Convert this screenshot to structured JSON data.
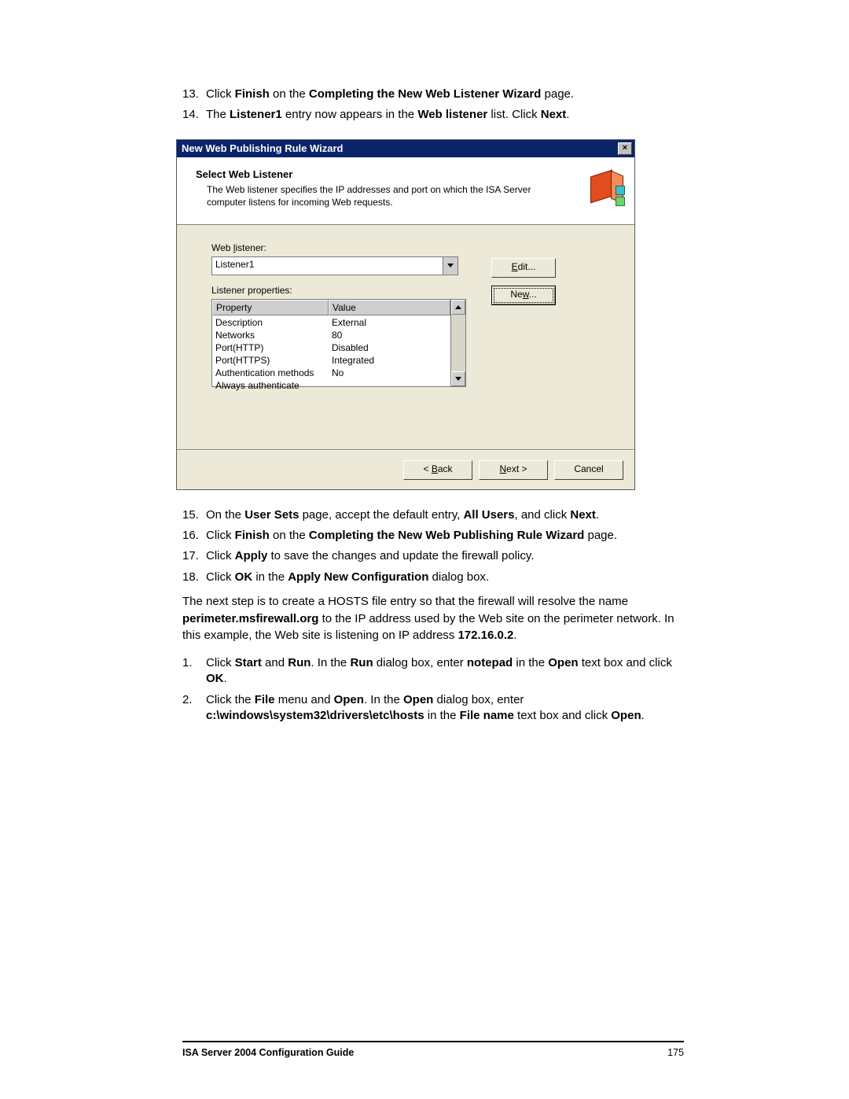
{
  "steps_top": [
    {
      "num": "13.",
      "html": "Click <b>Finish</b> on the <b>Completing the New Web Listener Wizard</b> page."
    },
    {
      "num": "14.",
      "html": "The <b>Listener1</b> entry now appears in the <b>Web listener</b> list. Click <b>Next</b>."
    }
  ],
  "dialog": {
    "title": "New Web Publishing Rule Wizard",
    "close": "×",
    "header_title": "Select Web Listener",
    "header_desc": "The Web listener specifies the IP addresses and port on which the ISA Server computer listens for incoming Web requests.",
    "web_listener_label": "Web listener:",
    "combo_value": "Listener1",
    "edit_btn": "Edit...",
    "new_btn": "New...",
    "listener_props_label": "Listener properties:",
    "col_property": "Property",
    "col_value": "Value",
    "rows": [
      {
        "p": "Description",
        "v": ""
      },
      {
        "p": "Networks",
        "v": "External"
      },
      {
        "p": "Port(HTTP)",
        "v": "80"
      },
      {
        "p": "Port(HTTPS)",
        "v": "Disabled"
      },
      {
        "p": "Authentication methods",
        "v": "Integrated"
      },
      {
        "p": "Always authenticate",
        "v": "No"
      }
    ],
    "back": "< Back",
    "next": "Next >",
    "cancel": "Cancel"
  },
  "steps_mid": [
    {
      "num": "15.",
      "html": "On the <b>User Sets</b> page, accept the default entry, <b>All Users</b>, and click <b>Next</b>."
    },
    {
      "num": "16.",
      "html": "Click <b>Finish</b> on the <b>Completing the New Web Publishing Rule Wizard</b> page."
    },
    {
      "num": "17.",
      "html": "Click <b>Apply</b> to save the changes and update the firewall policy."
    },
    {
      "num": "18.",
      "html": "Click <b>OK</b> in the <b>Apply New Configuration</b> dialog box."
    }
  ],
  "paragraph": "The next step is to create a HOSTS file entry so that the firewall will resolve the name <b>perimeter.msfirewall.org</b> to the IP address used by the Web site on the perimeter network. In this example, the Web site is listening on IP address <b>172.16.0.2</b>.",
  "steps_bottom": [
    {
      "num": "1.",
      "html": "Click <b>Start</b> and <b>Run</b>. In the <b>Run</b> dialog box, enter <b>notepad</b> in the <b>Open</b> text box and click <b>OK</b>."
    },
    {
      "num": "2.",
      "html": "Click the <b>File</b> menu and <b>Open</b>. In the <b>Open</b> dialog box, enter <b>c:\\windows\\system32\\drivers\\etc\\hosts</b> in the <b>File name</b> text box and click <b>Open</b>."
    }
  ],
  "footer_left": "ISA Server 2004 Configuration Guide",
  "footer_right": "175"
}
